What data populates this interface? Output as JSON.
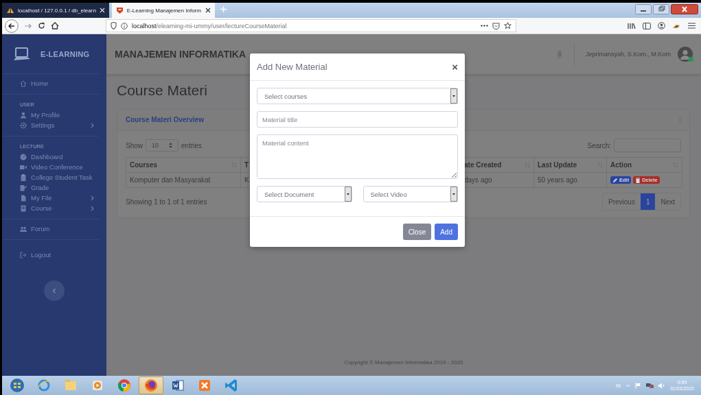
{
  "browser": {
    "tabs": [
      {
        "title": "localhost / 127.0.0.1 / db_elearn",
        "kind": "database",
        "selected": false
      },
      {
        "title": "E-Learning Manajemen Inform",
        "kind": "site",
        "selected": true
      }
    ],
    "url_host": "localhost",
    "url_path": "/elearning-mi-ummy/user/lectureCourseMaterial"
  },
  "sidebar": {
    "brand": "E-LEARNING",
    "sections": [
      {
        "items": [
          {
            "label": "Home",
            "kind": "home",
            "has_submenu": false
          }
        ]
      },
      {
        "heading": "USER",
        "items": [
          {
            "label": "My Profile",
            "kind": "user",
            "has_submenu": false
          },
          {
            "label": "Settings",
            "kind": "gear",
            "has_submenu": true
          }
        ]
      },
      {
        "heading": "LECTURE",
        "items": [
          {
            "label": "Dashboard",
            "kind": "gauge",
            "has_submenu": false
          },
          {
            "label": "Video Conference",
            "kind": "video",
            "has_submenu": false
          },
          {
            "label": "College Student Task",
            "kind": "clipboard",
            "has_submenu": false
          },
          {
            "label": "Grade",
            "kind": "edit",
            "has_submenu": false
          },
          {
            "label": "My File",
            "kind": "file",
            "has_submenu": true
          },
          {
            "label": "Course",
            "kind": "book",
            "has_submenu": true
          }
        ]
      },
      {
        "items": [
          {
            "label": "Forum",
            "kind": "users",
            "has_submenu": false
          }
        ]
      },
      {
        "items": [
          {
            "label": "Logout",
            "kind": "logout",
            "has_submenu": false
          }
        ]
      }
    ]
  },
  "topbar": {
    "title": "MANAJEMEN INFORMATIKA",
    "user": "Jeprimansyah, S.Kom., M.Kom",
    "online": true
  },
  "page": {
    "title": "Course Materi",
    "card": {
      "title": "Course Materi Overview",
      "show_label": "Show",
      "page_length": "10",
      "entries_label": "entries",
      "search_label": "Search:",
      "columns": [
        "Courses",
        "T",
        "ate Created",
        "Last Update",
        "Action"
      ],
      "rows": [
        {
          "cells": [
            "Komputer dan Masyarakat",
            "K",
            "days ago",
            "50 years ago"
          ],
          "actions": [
            {
              "label": "Edit",
              "kind": "edit"
            },
            {
              "label": "Delete",
              "kind": "delete"
            }
          ]
        }
      ],
      "info": "Showing 1 to 1 of 1 entries",
      "pagination": [
        {
          "label": "Previous",
          "selected": false
        },
        {
          "label": "1",
          "selected": true
        },
        {
          "label": "Next",
          "selected": false
        }
      ]
    },
    "footer": "Copyright © Manajemen Informatika 2019 - 2020"
  },
  "modal": {
    "title": "Add New Material",
    "close": "×",
    "fields": [
      {
        "kind": "select",
        "value": "Select courses"
      },
      {
        "kind": "input",
        "placeholder": "Material title"
      },
      {
        "kind": "textarea",
        "placeholder": "Material content"
      },
      {
        "kind": "row",
        "fields": [
          {
            "kind": "select",
            "value": "Select Document"
          },
          {
            "kind": "select",
            "value": "Select Video"
          }
        ]
      }
    ],
    "buttons": [
      {
        "label": "Close",
        "kind": "secondary"
      },
      {
        "label": "Add",
        "kind": "primary"
      }
    ]
  },
  "taskbar": {
    "apps": [
      {
        "kind": "start",
        "selected": false
      },
      {
        "kind": "ie",
        "selected": false
      },
      {
        "kind": "folder",
        "selected": false
      },
      {
        "kind": "media",
        "selected": false
      },
      {
        "kind": "chrome",
        "selected": false
      },
      {
        "kind": "firefox",
        "selected": true
      },
      {
        "kind": "word",
        "selected": false
      },
      {
        "kind": "xampp",
        "selected": false
      },
      {
        "kind": "vscode",
        "selected": false
      }
    ],
    "language": "IN",
    "time": "0:59",
    "date": "31/03/2020"
  }
}
